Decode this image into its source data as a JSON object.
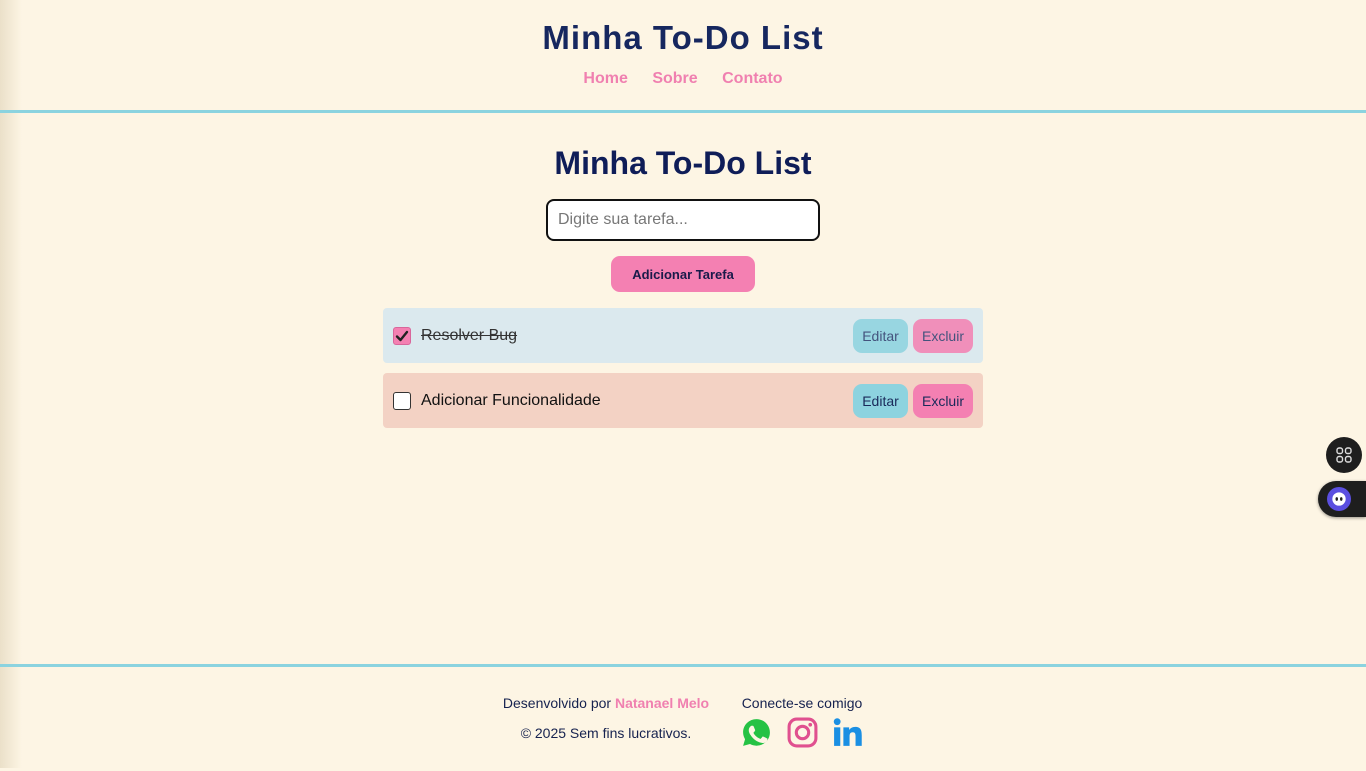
{
  "header": {
    "title": "Minha To-Do List",
    "nav": [
      "Home",
      "Sobre",
      "Contato"
    ]
  },
  "main": {
    "title": "Minha To-Do List",
    "input_placeholder": "Digite sua tarefa...",
    "input_value": "",
    "add_button": "Adicionar Tarefa",
    "tasks": [
      {
        "text": "Resolver Bug",
        "completed": true,
        "edit": "Editar",
        "delete": "Excluir"
      },
      {
        "text": "Adicionar Funcionalidade",
        "completed": false,
        "edit": "Editar",
        "delete": "Excluir"
      }
    ]
  },
  "footer": {
    "developed_by": "Desenvolvido por",
    "author": "Natanael Melo",
    "copyright": "© 2025 Sem fins lucrativos.",
    "connect": "Conecte-se comigo",
    "social_icons": [
      "whatsapp-icon",
      "instagram-icon",
      "linkedin-icon"
    ]
  },
  "colors": {
    "background": "#fdf5e4",
    "accent_pink": "#f480b2",
    "accent_cyan": "#8dd3df",
    "navy": "#16275f"
  }
}
